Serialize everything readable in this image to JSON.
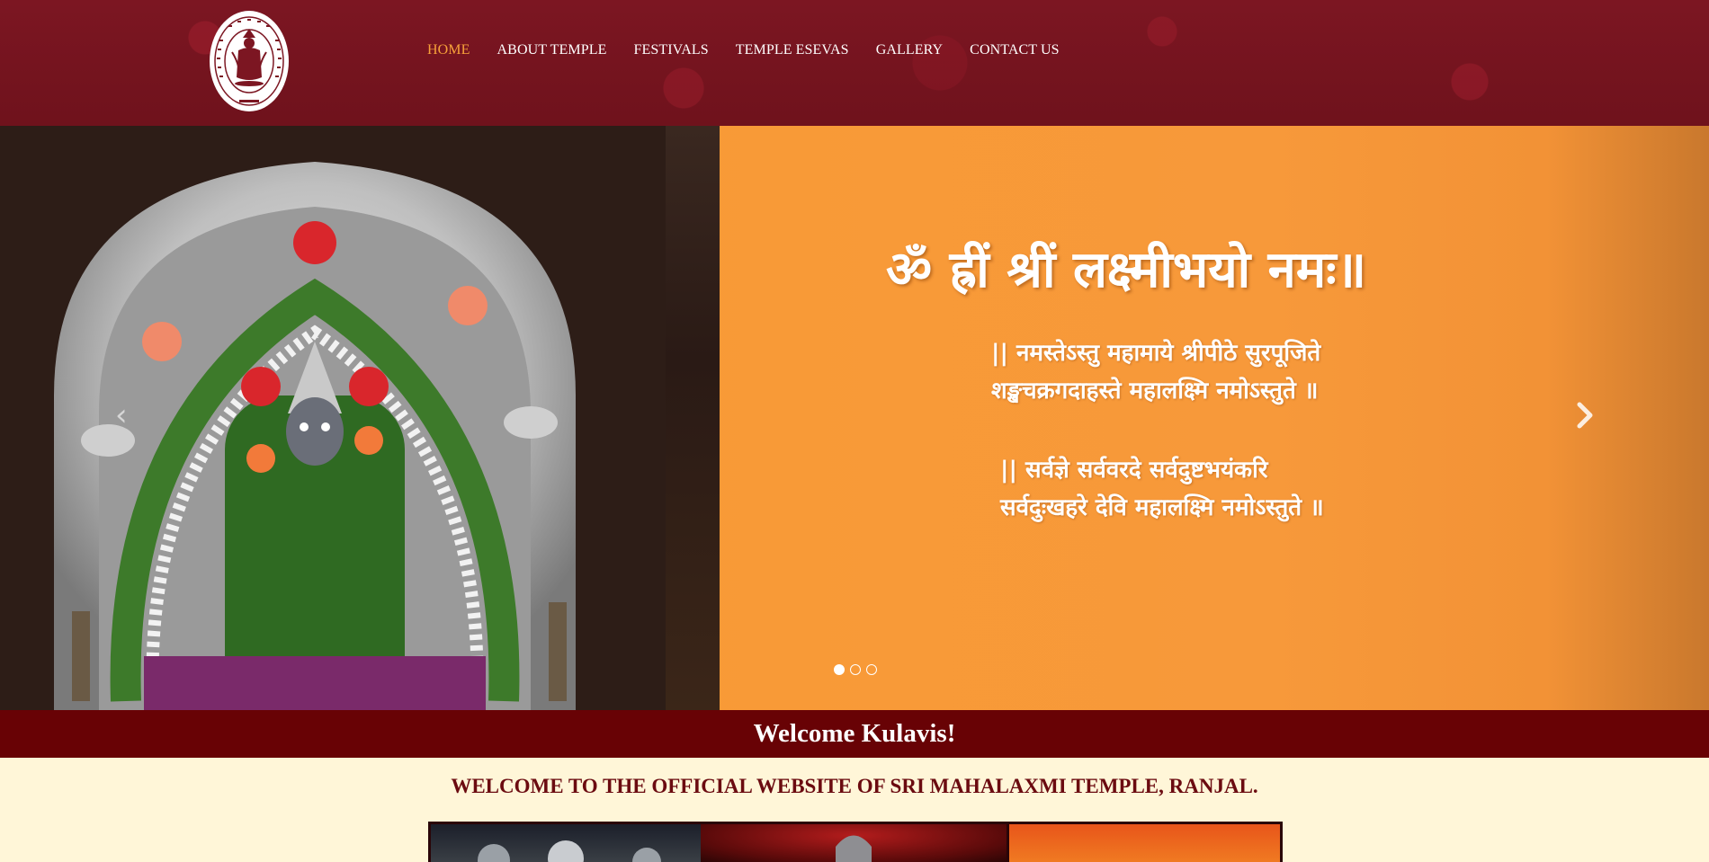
{
  "header": {
    "logo": {
      "ring_text": "SHREE MAHALAXMI TEMPLE",
      "bottom_text": "RANJAL",
      "icon": "goddess-emblem-icon"
    },
    "nav": [
      {
        "label": "HOME",
        "active": true
      },
      {
        "label": "ABOUT TEMPLE",
        "active": false
      },
      {
        "label": "FESTIVALS",
        "active": false
      },
      {
        "label": "TEMPLE eSEVAS",
        "active": false
      },
      {
        "label": "GALLERY",
        "active": false
      },
      {
        "label": "CONTACT US",
        "active": false
      }
    ]
  },
  "slider": {
    "mantra_title": "ॐ ह्रीं श्रीं लक्ष्मीभयो नमः॥",
    "verse1": [
      "|| नमस्तेऽस्तु महामाये श्रीपीठे सुरपूजिते",
      "शङ्खचक्रगदाहस्ते महालक्ष्मि नमोऽस्तुते ॥"
    ],
    "verse2": [
      "|| सर्वज्ञे सर्ववरदे सर्वदुष्टभयंकरि",
      "सर्वदुःखहरे देवि महालक्ष्मि नमोऽस्तुते ॥"
    ],
    "prev_icon": "chevron-left-icon",
    "next_icon": "chevron-right-icon",
    "slide_count": 3,
    "active_slide": 1
  },
  "welcome": {
    "band_text": "Welcome Kulavis!",
    "heading": "WELCOME TO THE OFFICIAL WEBSITE OF SRI MAHALAXMI TEMPLE, RANJAL."
  },
  "colors": {
    "header_bg": "#7c1622",
    "nav_active": "#f7a13a",
    "band_bg": "#680205",
    "heading": "#6b0b10",
    "page_bg": "#fff6d8",
    "slide_orange": "#f89a36"
  }
}
